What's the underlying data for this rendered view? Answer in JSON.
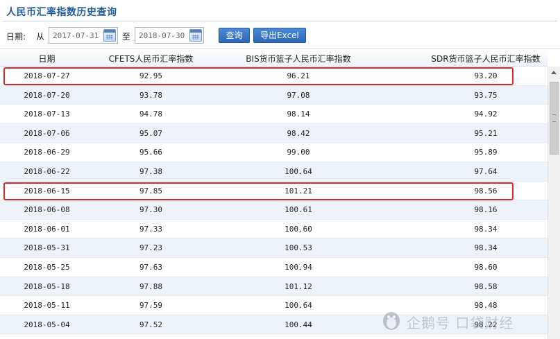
{
  "page": {
    "title": "人民币汇率指数历史查询"
  },
  "filter": {
    "date_label": "日期:",
    "from_label": "从",
    "from_value": "2017-07-31",
    "to_label": "至",
    "to_value": "2018-07-30",
    "query_button": "查询",
    "export_button": "导出Excel"
  },
  "table": {
    "headers": [
      "日期",
      "CFETS人民币汇率指数",
      "BIS货币篮子人民币汇率指数",
      "SDR货币篮子人民币汇率指数"
    ],
    "rows": [
      [
        "2018-07-27",
        "92.95",
        "96.21",
        "93.20"
      ],
      [
        "2018-07-20",
        "93.78",
        "97.08",
        "93.75"
      ],
      [
        "2018-07-13",
        "94.78",
        "98.14",
        "94.92"
      ],
      [
        "2018-07-06",
        "95.07",
        "98.42",
        "95.21"
      ],
      [
        "2018-06-29",
        "95.66",
        "99.00",
        "95.89"
      ],
      [
        "2018-06-22",
        "97.38",
        "100.64",
        "97.64"
      ],
      [
        "2018-06-15",
        "97.85",
        "101.21",
        "98.56"
      ],
      [
        "2018-06-08",
        "97.30",
        "100.61",
        "98.16"
      ],
      [
        "2018-06-01",
        "97.33",
        "100.60",
        "98.34"
      ],
      [
        "2018-05-31",
        "97.23",
        "100.53",
        "98.34"
      ],
      [
        "2018-05-25",
        "97.63",
        "100.94",
        "98.60"
      ],
      [
        "2018-05-18",
        "97.88",
        "101.12",
        "98.58"
      ],
      [
        "2018-05-11",
        "97.59",
        "100.64",
        "98.48"
      ],
      [
        "2018-05-04",
        "97.52",
        "100.44",
        "98.22"
      ]
    ],
    "highlighted_rows": [
      "2018-07-27",
      "2018-06-15"
    ]
  },
  "watermark": {
    "text": "企鹅号 口袋财经"
  },
  "colors": {
    "title": "#1f5d99",
    "button": "#2d68b5",
    "row_alt": "#eef3f9",
    "highlight": "#e0262a"
  }
}
